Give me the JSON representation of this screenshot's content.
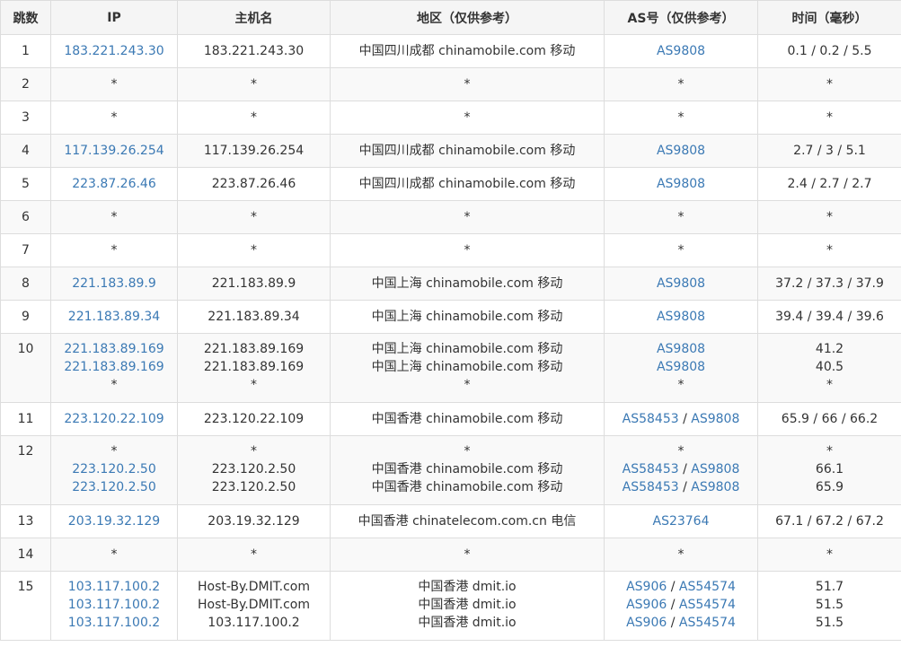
{
  "headers": [
    "跳数",
    "IP",
    "主机名",
    "地区（仅供参考）",
    "AS号（仅供参考）",
    "时间（毫秒）"
  ],
  "rows": [
    {
      "hop": "1",
      "lines": [
        {
          "ip": "183.221.243.30",
          "host": "183.221.243.30",
          "region": "中国四川成都 chinamobile.com 移动",
          "as": [
            "AS9808"
          ],
          "time": "0.1 / 0.2 / 5.5"
        }
      ]
    },
    {
      "hop": "2",
      "lines": [
        {
          "ip": "*",
          "host": "*",
          "region": "*",
          "as": [
            "*"
          ],
          "time": "*"
        }
      ]
    },
    {
      "hop": "3",
      "lines": [
        {
          "ip": "*",
          "host": "*",
          "region": "*",
          "as": [
            "*"
          ],
          "time": "*"
        }
      ]
    },
    {
      "hop": "4",
      "lines": [
        {
          "ip": "117.139.26.254",
          "host": "117.139.26.254",
          "region": "中国四川成都 chinamobile.com 移动",
          "as": [
            "AS9808"
          ],
          "time": "2.7 / 3 / 5.1"
        }
      ]
    },
    {
      "hop": "5",
      "lines": [
        {
          "ip": "223.87.26.46",
          "host": "223.87.26.46",
          "region": "中国四川成都 chinamobile.com 移动",
          "as": [
            "AS9808"
          ],
          "time": "2.4 / 2.7 / 2.7"
        }
      ]
    },
    {
      "hop": "6",
      "lines": [
        {
          "ip": "*",
          "host": "*",
          "region": "*",
          "as": [
            "*"
          ],
          "time": "*"
        }
      ]
    },
    {
      "hop": "7",
      "lines": [
        {
          "ip": "*",
          "host": "*",
          "region": "*",
          "as": [
            "*"
          ],
          "time": "*"
        }
      ]
    },
    {
      "hop": "8",
      "lines": [
        {
          "ip": "221.183.89.9",
          "host": "221.183.89.9",
          "region": "中国上海 chinamobile.com 移动",
          "as": [
            "AS9808"
          ],
          "time": "37.2 / 37.3 / 37.9"
        }
      ]
    },
    {
      "hop": "9",
      "lines": [
        {
          "ip": "221.183.89.34",
          "host": "221.183.89.34",
          "region": "中国上海 chinamobile.com 移动",
          "as": [
            "AS9808"
          ],
          "time": "39.4 / 39.4 / 39.6"
        }
      ]
    },
    {
      "hop": "10",
      "lines": [
        {
          "ip": "221.183.89.169",
          "host": "221.183.89.169",
          "region": "中国上海 chinamobile.com 移动",
          "as": [
            "AS9808"
          ],
          "time": "41.2"
        },
        {
          "ip": "221.183.89.169",
          "host": "221.183.89.169",
          "region": "中国上海 chinamobile.com 移动",
          "as": [
            "AS9808"
          ],
          "time": "40.5"
        },
        {
          "ip": "*",
          "host": "*",
          "region": "*",
          "as": [
            "*"
          ],
          "time": "*"
        }
      ]
    },
    {
      "hop": "11",
      "lines": [
        {
          "ip": "223.120.22.109",
          "host": "223.120.22.109",
          "region": "中国香港 chinamobile.com 移动",
          "as": [
            "AS58453",
            "AS9808"
          ],
          "time": "65.9 / 66 / 66.2"
        }
      ]
    },
    {
      "hop": "12",
      "lines": [
        {
          "ip": "*",
          "host": "*",
          "region": "*",
          "as": [
            "*"
          ],
          "time": "*"
        },
        {
          "ip": "223.120.2.50",
          "host": "223.120.2.50",
          "region": "中国香港 chinamobile.com 移动",
          "as": [
            "AS58453",
            "AS9808"
          ],
          "time": "66.1"
        },
        {
          "ip": "223.120.2.50",
          "host": "223.120.2.50",
          "region": "中国香港 chinamobile.com 移动",
          "as": [
            "AS58453",
            "AS9808"
          ],
          "time": "65.9"
        }
      ]
    },
    {
      "hop": "13",
      "lines": [
        {
          "ip": "203.19.32.129",
          "host": "203.19.32.129",
          "region": "中国香港 chinatelecom.com.cn 电信",
          "as": [
            "AS23764"
          ],
          "time": "67.1 / 67.2 / 67.2"
        }
      ]
    },
    {
      "hop": "14",
      "lines": [
        {
          "ip": "*",
          "host": "*",
          "region": "*",
          "as": [
            "*"
          ],
          "time": "*"
        }
      ]
    },
    {
      "hop": "15",
      "lines": [
        {
          "ip": "103.117.100.2",
          "host": "Host-By.DMIT.com",
          "region": "中国香港 dmit.io",
          "as": [
            "AS906",
            "AS54574"
          ],
          "time": "51.7"
        },
        {
          "ip": "103.117.100.2",
          "host": "Host-By.DMIT.com",
          "region": "中国香港 dmit.io",
          "as": [
            "AS906",
            "AS54574"
          ],
          "time": "51.5"
        },
        {
          "ip": "103.117.100.2",
          "host": "103.117.100.2",
          "region": "中国香港 dmit.io",
          "as": [
            "AS906",
            "AS54574"
          ],
          "time": "51.5"
        }
      ]
    }
  ],
  "colors": {
    "link": "#3b79b4",
    "header_bg": "#f5f5f5",
    "alt_row_bg": "#f9f9f9",
    "border": "#dddddd",
    "text": "#333333"
  }
}
